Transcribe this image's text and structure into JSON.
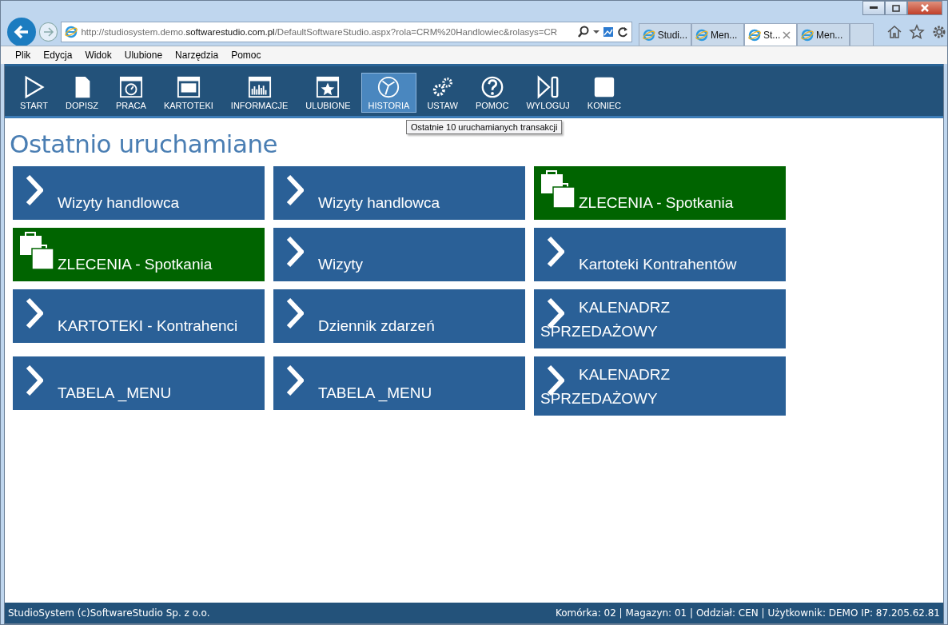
{
  "browser": {
    "url": {
      "prefix": "http://studiosystem.demo.",
      "domain": "softwarestudio.com.pl",
      "suffix": "/DefaultSoftwareStudio.aspx?rola=CRM%20Handlowiec&rolasys=CR"
    },
    "tabs": [
      {
        "label": "Studi...",
        "selected": false
      },
      {
        "label": "Men...",
        "selected": false
      },
      {
        "label": "St...",
        "selected": true
      },
      {
        "label": "Men...",
        "selected": false
      }
    ],
    "menu": [
      "Plik",
      "Edycja",
      "Widok",
      "Ulubione",
      "Narzędzia",
      "Pomoc"
    ]
  },
  "toolbar": [
    {
      "label": "START",
      "kind": "play",
      "selected": false
    },
    {
      "label": "DOPISZ",
      "kind": "page",
      "selected": false
    },
    {
      "label": "PRACA",
      "kind": "clock",
      "selected": false
    },
    {
      "label": "KARTOTEKI",
      "kind": "window",
      "selected": false
    },
    {
      "label": "INFORMACJE",
      "kind": "chart",
      "selected": false
    },
    {
      "label": "ULUBIONE",
      "kind": "star",
      "selected": false
    },
    {
      "label": "HISTORIA",
      "kind": "history",
      "selected": true
    },
    {
      "label": "USTAW",
      "kind": "gears",
      "selected": false
    },
    {
      "label": "POMOC",
      "kind": "help",
      "selected": false
    },
    {
      "label": "WYLOGUJ",
      "kind": "logout",
      "selected": false
    },
    {
      "label": "KONIEC",
      "kind": "stop",
      "selected": false
    }
  ],
  "tooltip": "Ostatnie 10 uruchamianych transakcji",
  "heading": "Ostatnio uruchamiane",
  "tiles": [
    {
      "label": "Wizyty handlowca",
      "kind": "arrow",
      "color": "#2a6097"
    },
    {
      "label": "Wizyty handlowca",
      "kind": "arrow",
      "color": "#2a6097"
    },
    {
      "label": "ZLECENIA - Spotkania",
      "kind": "briefcase",
      "color": "#006400"
    },
    {
      "label": "ZLECENIA - Spotkania",
      "kind": "briefcase",
      "color": "#006400"
    },
    {
      "label": "Wizyty",
      "kind": "arrow",
      "color": "#2a6097"
    },
    {
      "label": "Kartoteki Kontrahentów",
      "kind": "arrow",
      "color": "#2a6097"
    },
    {
      "label": "KARTOTEKI - Kontrahenci",
      "kind": "arrow",
      "color": "#2a6097"
    },
    {
      "label": "Dziennik zdarzeń",
      "kind": "arrow",
      "color": "#2a6097"
    },
    {
      "label": "KALENADRZ SPRZEDAŻOWY",
      "kind": "arrow",
      "color": "#2a6097"
    },
    {
      "label": "TABELA _MENU",
      "kind": "arrow",
      "color": "#2a6097"
    },
    {
      "label": "TABELA _MENU",
      "kind": "arrow",
      "color": "#2a6097"
    },
    {
      "label": "KALENADRZ SPRZEDAŻOWY",
      "kind": "arrow",
      "color": "#2a6097"
    }
  ],
  "status_bar": {
    "left": "StudioSystem (c)SoftwareStudio Sp. z o.o.",
    "right": "Komórka: 02 | Magazyn: 01 | Oddział: CEN | Użytkownik: DEMO IP: 87.205.62.81"
  }
}
